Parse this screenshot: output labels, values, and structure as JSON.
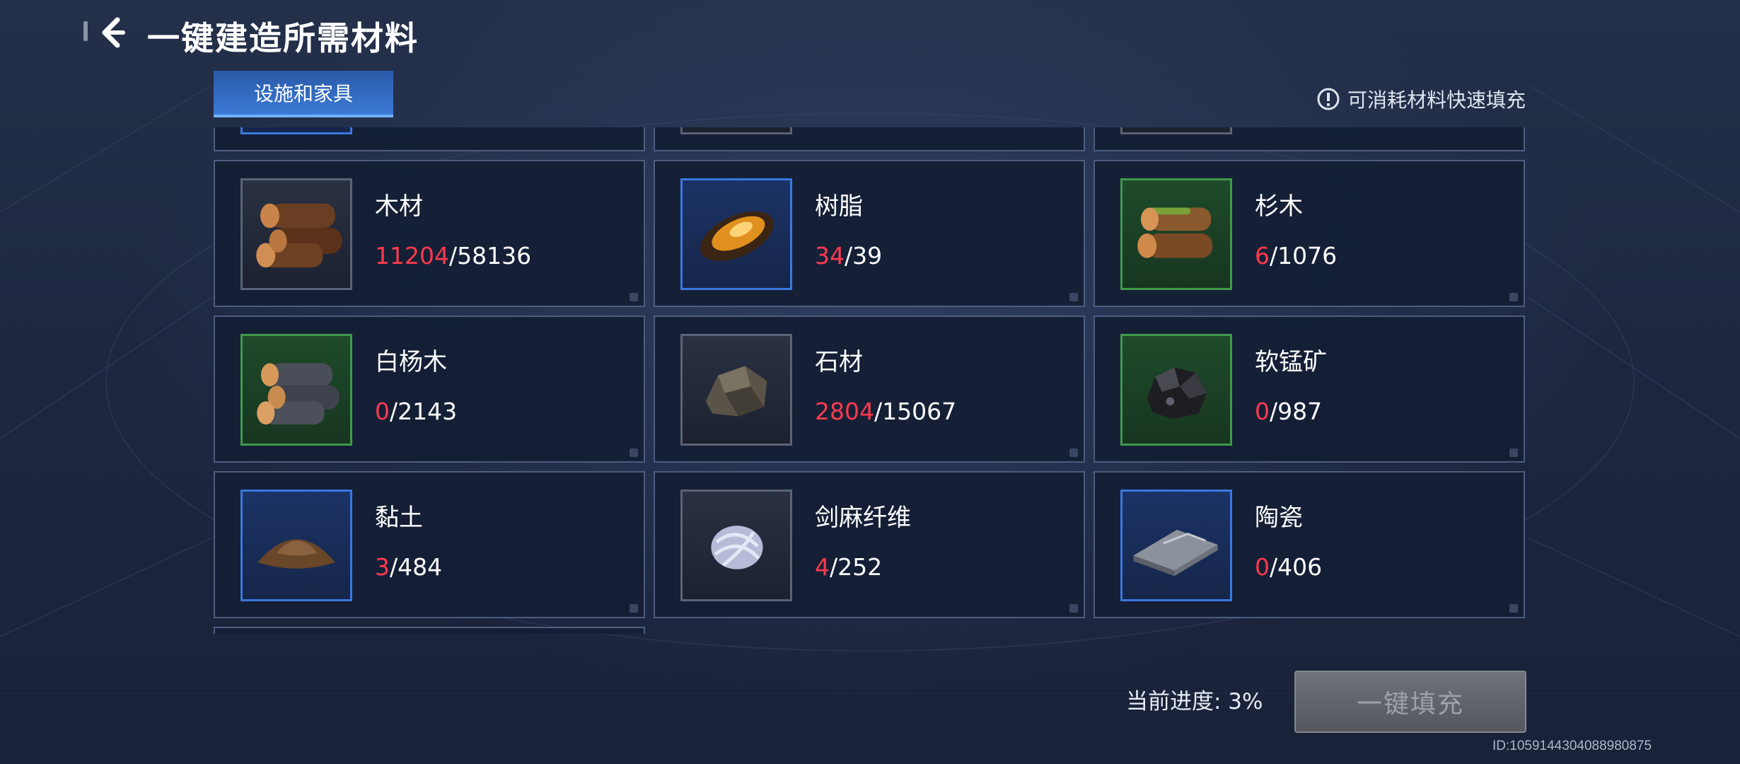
{
  "header": {
    "title": "一键建造所需材料"
  },
  "tabs": [
    {
      "label": "设施和家具"
    }
  ],
  "quick_fill": {
    "label": "可消耗材料快速填充"
  },
  "materials": [
    {
      "name": "木材",
      "have": "11204",
      "need": "/58136",
      "quality": "gray",
      "icon": "wood-logs-icon"
    },
    {
      "name": "树脂",
      "have": "34",
      "need": "/39",
      "quality": "blue",
      "icon": "resin-icon"
    },
    {
      "name": "杉木",
      "have": "6",
      "need": "/1076",
      "quality": "green",
      "icon": "fir-wood-icon"
    },
    {
      "name": "白杨木",
      "have": "0",
      "need": "/2143",
      "quality": "green",
      "icon": "poplar-wood-icon"
    },
    {
      "name": "石材",
      "have": "2804",
      "need": "/15067",
      "quality": "gray",
      "icon": "stone-icon"
    },
    {
      "name": "软锰矿",
      "have": "0",
      "need": "/987",
      "quality": "green",
      "icon": "pyrolusite-ore-icon"
    },
    {
      "name": "黏土",
      "have": "3",
      "need": "/484",
      "quality": "blue",
      "icon": "clay-icon"
    },
    {
      "name": "剑麻纤维",
      "have": "4",
      "need": "/252",
      "quality": "gray",
      "icon": "sisal-fiber-icon"
    },
    {
      "name": "陶瓷",
      "have": "0",
      "need": "/406",
      "quality": "blue",
      "icon": "ceramic-plate-icon"
    }
  ],
  "progress": {
    "label": "当前进度: 3%",
    "value_percent": 3
  },
  "fill_button": {
    "label": "一键填充"
  },
  "footer": {
    "id": "ID:1059144304088980875"
  },
  "colors": {
    "have_value": "#ff3a4e",
    "tab_active": "#3c7ad6",
    "quality_blue": "#3a78e0",
    "quality_green": "#3f9a4a",
    "quality_gray": "#5b6374"
  }
}
